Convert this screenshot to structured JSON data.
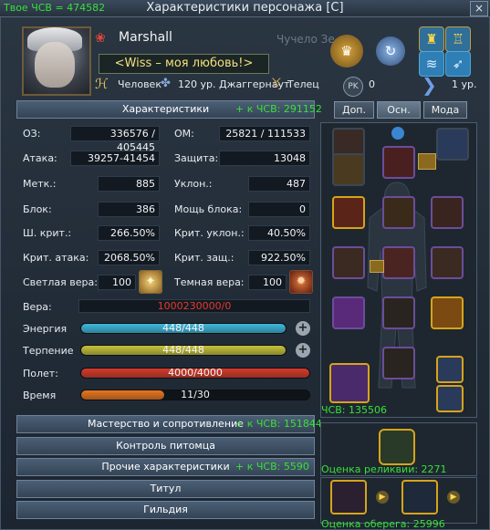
{
  "window": {
    "title": "Характеристики персонажа [C]",
    "tvs": "Твое ЧСВ = 474582",
    "close": "×"
  },
  "character": {
    "name": "Marshall",
    "guild_text": "<Wiss – моя любовь!>",
    "race": "Человек",
    "level": "120 ур. Джаггернаут",
    "zodiac": "Телец",
    "ghost_text": "Чучело Зе",
    "pk_label": "PK",
    "pk_value": "0",
    "rank_level": "1 ур."
  },
  "sections": {
    "stats": {
      "title": "Характеристики",
      "bonus": "+ к ЧСВ: 291152"
    },
    "mastery": {
      "title": "Мастерство и сопротивление",
      "bonus": "+ к ЧСВ: 151844"
    },
    "pet": {
      "title": "Контроль питомца"
    },
    "other": {
      "title": "Прочие характеристики",
      "bonus": "+ к ЧСВ: 5590"
    },
    "titles": {
      "title": "Титул"
    },
    "guild": {
      "title": "Гильдия"
    }
  },
  "stats": [
    {
      "label": "ОЗ:",
      "value": "336576 / 405445"
    },
    {
      "label": "ОМ:",
      "value": "25821 / 111533"
    },
    {
      "label": "Атака:",
      "value": "39257-41454"
    },
    {
      "label": "Защита:",
      "value": "13048"
    },
    {
      "label": "Метк.:",
      "value": "885"
    },
    {
      "label": "Уклон.:",
      "value": "487"
    },
    {
      "label": "Блок:",
      "value": "386"
    },
    {
      "label": "Мощь блока:",
      "value": "0"
    },
    {
      "label": "Ш. крит.:",
      "value": "266.50%"
    },
    {
      "label": "Крит. уклон.:",
      "value": "40.50%"
    },
    {
      "label": "Крит. атака:",
      "value": "2068.50%"
    },
    {
      "label": "Крит. защ.:",
      "value": "922.50%"
    },
    {
      "label": "Светлая вера:",
      "value": "100"
    },
    {
      "label": "Темная вера:",
      "value": "100"
    }
  ],
  "faith": {
    "label": "Вера:",
    "value": "1000230000/0"
  },
  "bars": [
    {
      "label": "Энергия",
      "text": "448/448",
      "fill": 1.0,
      "color": "#3fb8dc"
    },
    {
      "label": "Терпение",
      "text": "448/448",
      "fill": 1.0,
      "color": "#c6c23a"
    },
    {
      "label": "Полет:",
      "text": "4000/4000",
      "fill": 1.0,
      "color": "#d63b2a"
    },
    {
      "label": "Время",
      "text": "11/30",
      "fill": 0.37,
      "color": "#e8761f"
    }
  ],
  "tabs": [
    {
      "label": "Доп."
    },
    {
      "label": "Осн."
    },
    {
      "label": "Мода"
    }
  ],
  "equipment": {
    "tvs": "ЧСВ: 135506"
  },
  "relic": {
    "label": "Оценка реликвии: 2271"
  },
  "charm": {
    "label": "Оценка оберега: 25996"
  }
}
